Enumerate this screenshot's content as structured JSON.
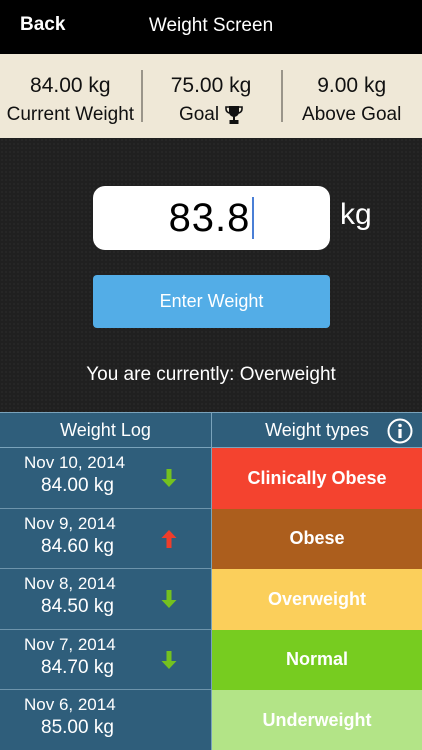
{
  "header": {
    "back_label": "Back",
    "title": "Weight Screen"
  },
  "stats": {
    "current_value": "84.00 kg",
    "current_label": "Current Weight",
    "goal_value": "75.00 kg",
    "goal_label": "Goal",
    "above_value": "9.00 kg",
    "above_label": "Above Goal"
  },
  "entry": {
    "input_value": "83.8",
    "unit": "kg",
    "enter_label": "Enter Weight",
    "status_text": "You are currently: Overweight"
  },
  "log": {
    "header": "Weight Log",
    "rows": [
      {
        "date": "Nov 10, 2014",
        "value": "84.00 kg",
        "trend": "down"
      },
      {
        "date": "Nov 9, 2014",
        "value": "84.60 kg",
        "trend": "up"
      },
      {
        "date": "Nov 8, 2014",
        "value": "84.50 kg",
        "trend": "down"
      },
      {
        "date": "Nov 7, 2014",
        "value": "84.70 kg",
        "trend": "down"
      },
      {
        "date": "Nov 6, 2014",
        "value": "85.00 kg",
        "trend": "none"
      }
    ]
  },
  "types": {
    "header": "Weight types",
    "bands": [
      {
        "label": "Clinically Obese",
        "color": "#f4432f"
      },
      {
        "label": "Obese",
        "color": "#ac5e1d"
      },
      {
        "label": "Overweight",
        "color": "#fbcf5b"
      },
      {
        "label": "Normal",
        "color": "#77cc20"
      },
      {
        "label": "Underweight",
        "color": "#b3e487"
      }
    ]
  },
  "colors": {
    "trend_down": "#74c11f",
    "trend_up": "#ef3d2b"
  }
}
